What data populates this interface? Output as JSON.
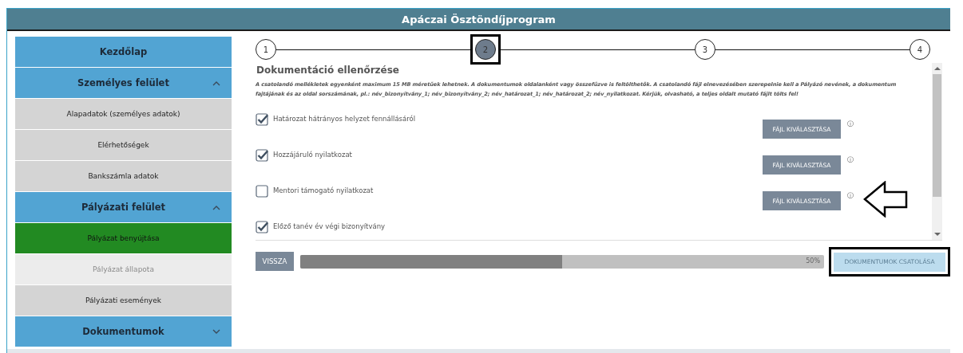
{
  "header": {
    "title": "Apáczai Ösztöndíjprogram"
  },
  "sidebar": {
    "items": [
      {
        "kind": "link",
        "label": "Kezdőlap"
      },
      {
        "kind": "section",
        "label": "Személyes felület",
        "expanded": true
      },
      {
        "kind": "item",
        "label": "Alapadatok (személyes adatok)",
        "selected": false,
        "disabled": false
      },
      {
        "kind": "item",
        "label": "Elérhetőségek",
        "selected": false,
        "disabled": false
      },
      {
        "kind": "item",
        "label": "Bankszámla adatok",
        "selected": false,
        "disabled": false
      },
      {
        "kind": "section",
        "label": "Pályázati felület",
        "expanded": true
      },
      {
        "kind": "item",
        "label": "Pályázat benyújtása",
        "selected": true,
        "disabled": false
      },
      {
        "kind": "item",
        "label": "Pályázat állapota",
        "selected": false,
        "disabled": true
      },
      {
        "kind": "item",
        "label": "Pályázati események",
        "selected": false,
        "disabled": false
      },
      {
        "kind": "section",
        "label": "Dokumentumok",
        "expanded": false
      }
    ]
  },
  "stepper": {
    "steps": [
      {
        "label": "1",
        "selected": false
      },
      {
        "label": "2",
        "selected": true
      },
      {
        "label": "3",
        "selected": false
      },
      {
        "label": "4",
        "selected": false
      }
    ]
  },
  "documents": {
    "title": "Dokumentáció ellenőrzése",
    "note": "A csatolandó mellékletek egyenként maximum 15 MB méretűek lehetnek. A dokumentumok oldalanként vagy összefűzve is feltölthetők. A csatolandó fájl elnevezésében szerepelnie kell a Pályázó nevének, a dokumentum fajtájának és az oldal sorszámának, pl.: név_bizonyítvány_1; név_bizonyítvány_2; név_határozat_1; név_határozat_2; név_nyilatkozat. Kérjük, olvasható, a teljes oldalt mutató fájlt tölts fel!",
    "items": [
      {
        "label": "Határozat hátrányos helyzet fennállásáról",
        "checked": true,
        "button": "FÁJL KIVÁLASZTÁSA",
        "info": "ⓘ"
      },
      {
        "label": "Hozzájáruló nyilatkozat",
        "checked": true,
        "button": "FÁJL KIVÁLASZTÁSA",
        "info": "ⓘ"
      },
      {
        "label": "Mentori támogató nyilatkozat",
        "checked": false,
        "button": "FÁJL KIVÁLASZTÁSA",
        "info": "ⓘ",
        "pointed": true
      },
      {
        "label": "Előző tanév év végi bizonyítvány",
        "checked": true
      }
    ]
  },
  "footer": {
    "back": "VISSZA",
    "progress": {
      "level": 0.5,
      "reading": "50%"
    },
    "submit": {
      "label": "DOKUMENTUMOK CSATOLÁSA",
      "disabled": true
    }
  }
}
